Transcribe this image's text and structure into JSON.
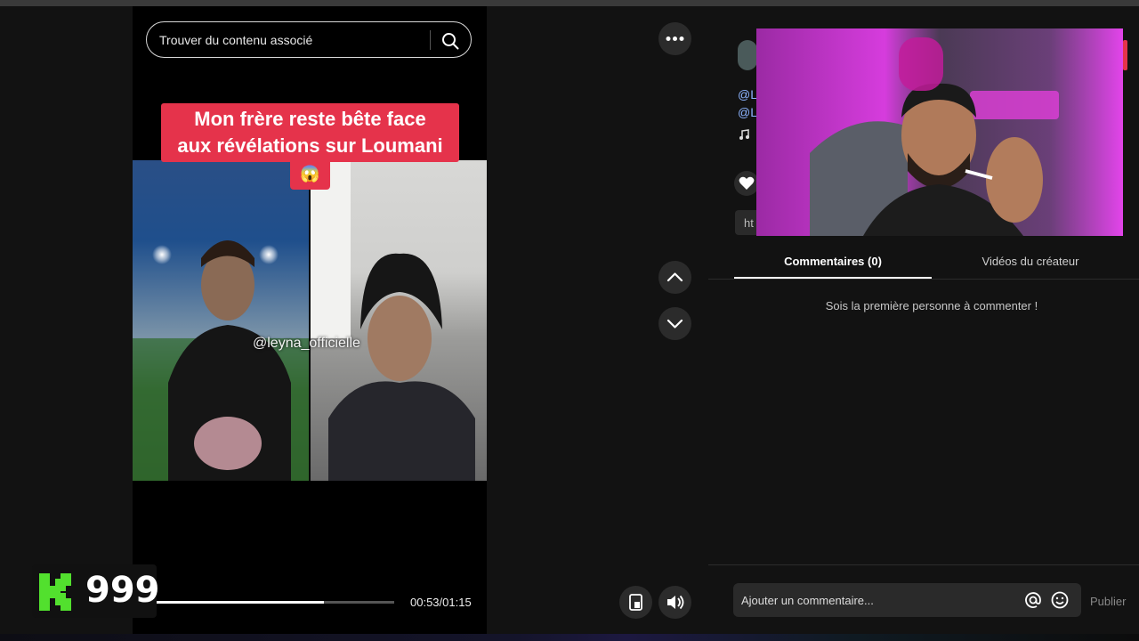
{
  "search": {
    "placeholder": "Trouver du contenu associé"
  },
  "video": {
    "caption_line1": "Mon frère reste bête face",
    "caption_line2": "aux révélations sur Loumani",
    "caption_emoji": "😱",
    "watermark": "@leyna_officielle",
    "progress": 0.71,
    "time": "00:53/01:15"
  },
  "overlay": {
    "kick_viewers": "999"
  },
  "sidebar": {
    "peek_handle1": "@L",
    "peek_handle2": "@L",
    "peek_link": "ht",
    "tabs": [
      {
        "label": "Commentaires (0)",
        "active": true
      },
      {
        "label": "Vidéos du créateur",
        "active": false
      }
    ],
    "empty_message": "Sois la première personne à commenter !",
    "comment_placeholder": "Ajouter un commentaire...",
    "publish_label": "Publier"
  },
  "colors": {
    "accent": "#e5334b",
    "kick_green": "#52e02e",
    "background": "#121212"
  },
  "icons": [
    "search-icon",
    "more-icon",
    "chevron-up-icon",
    "chevron-down-icon",
    "pip-icon",
    "volume-icon",
    "at-icon",
    "emoji-icon",
    "heart-icon",
    "music-icon"
  ]
}
